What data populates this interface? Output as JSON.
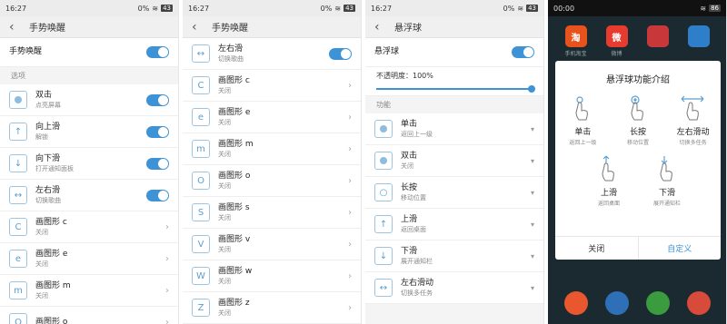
{
  "screen1": {
    "status": {
      "time": "16:27",
      "battery_pct": "0%",
      "signal": "43"
    },
    "title": "手势唤醒",
    "master": {
      "label": "手势唤醒"
    },
    "section": "选项",
    "items": [
      {
        "main": "双击",
        "sub": "点亮屏幕",
        "icon": "dot-icon",
        "control": "toggle"
      },
      {
        "main": "向上滑",
        "sub": "解锁",
        "icon": "arrow-up-icon",
        "control": "toggle"
      },
      {
        "main": "向下滑",
        "sub": "打开通知面板",
        "icon": "arrow-down-icon",
        "control": "toggle"
      },
      {
        "main": "左右滑",
        "sub": "切换歌曲",
        "icon": "arrows-horizontal-icon",
        "control": "toggle"
      },
      {
        "main": "画图形 c",
        "sub": "关闭",
        "icon": "shape-c-icon",
        "control": "chevron"
      },
      {
        "main": "画图形 e",
        "sub": "关闭",
        "icon": "shape-e-icon",
        "control": "chevron"
      },
      {
        "main": "画图形 m",
        "sub": "关闭",
        "icon": "shape-m-icon",
        "control": "chevron"
      },
      {
        "main": "画图形 o",
        "sub": "",
        "icon": "shape-o-icon",
        "control": "chevron"
      }
    ]
  },
  "screen2": {
    "status": {
      "time": "16:27",
      "battery_pct": "0%",
      "signal": "43"
    },
    "title": "手势唤醒",
    "items": [
      {
        "main": "左右滑",
        "sub": "切换歌曲",
        "icon": "arrows-horizontal-icon",
        "control": "toggle"
      },
      {
        "main": "画图形 c",
        "sub": "关闭",
        "icon": "shape-c-icon",
        "control": "chevron"
      },
      {
        "main": "画图形 e",
        "sub": "关闭",
        "icon": "shape-e-icon",
        "control": "chevron"
      },
      {
        "main": "画图形 m",
        "sub": "关闭",
        "icon": "shape-m-icon",
        "control": "chevron"
      },
      {
        "main": "画图形 o",
        "sub": "关闭",
        "icon": "shape-o-icon",
        "control": "chevron"
      },
      {
        "main": "画图形 s",
        "sub": "关闭",
        "icon": "shape-s-icon",
        "control": "chevron"
      },
      {
        "main": "画图形 v",
        "sub": "关闭",
        "icon": "shape-v-icon",
        "control": "chevron"
      },
      {
        "main": "画图形 w",
        "sub": "关闭",
        "icon": "shape-w-icon",
        "control": "chevron"
      },
      {
        "main": "画图形 z",
        "sub": "关闭",
        "icon": "shape-z-icon",
        "control": "chevron"
      }
    ]
  },
  "screen3": {
    "status": {
      "time": "16:27",
      "battery_pct": "0%",
      "signal": "43"
    },
    "title": "悬浮球",
    "master": {
      "label": "悬浮球"
    },
    "opacity": {
      "label": "不透明度：100%",
      "value": 1.0
    },
    "section": "功能",
    "items": [
      {
        "main": "单击",
        "sub": "返回上一级",
        "icon": "dot-icon"
      },
      {
        "main": "双击",
        "sub": "关闭",
        "icon": "dot-icon"
      },
      {
        "main": "长按",
        "sub": "移动位置",
        "icon": "circle-icon"
      },
      {
        "main": "上滑",
        "sub": "返回桌面",
        "icon": "arrow-up-icon"
      },
      {
        "main": "下滑",
        "sub": "展开通知栏",
        "icon": "arrow-down-icon"
      },
      {
        "main": "左右滑动",
        "sub": "切换多任务",
        "icon": "arrows-horizontal-icon"
      }
    ]
  },
  "screen4": {
    "status": {
      "time": "00:00",
      "signal": "86"
    },
    "apps": [
      {
        "label": "手机淘宝",
        "glyph": "淘",
        "color": "#e8521c"
      },
      {
        "label": "微博",
        "glyph": "微",
        "color": "#e63b2e"
      },
      {
        "label": "",
        "glyph": "",
        "color": "#c8383a"
      },
      {
        "label": "",
        "glyph": "",
        "color": "#2f7ec9"
      }
    ],
    "dialog": {
      "title": "悬浮球功能介绍",
      "gestures_row1": [
        {
          "name": "单击",
          "desc": "返回上一级",
          "icon": "tap-hand-icon"
        },
        {
          "name": "长按",
          "desc": "移动位置",
          "icon": "long-press-hand-icon"
        },
        {
          "name": "左右滑动",
          "desc": "切换多任务",
          "icon": "swipe-horizontal-hand-icon"
        }
      ],
      "gestures_row2": [
        {
          "name": "上滑",
          "desc": "返回桌面",
          "icon": "swipe-up-hand-icon"
        },
        {
          "name": "下滑",
          "desc": "展开通知栏",
          "icon": "swipe-down-hand-icon"
        }
      ],
      "close_label": "关闭",
      "custom_label": "自定义"
    },
    "dock_colors": [
      "#e9572e",
      "#2f6fb8",
      "#3a9b3f",
      "#d84a3a"
    ]
  }
}
